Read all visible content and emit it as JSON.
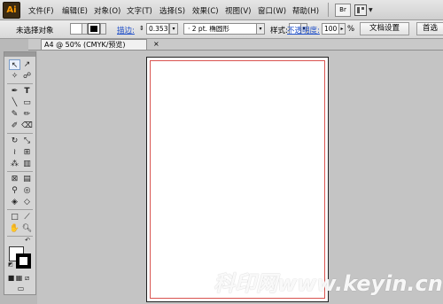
{
  "app": {
    "logo": "Ai"
  },
  "menu": {
    "items": [
      "文件(F)",
      "编辑(E)",
      "对象(O)",
      "文字(T)",
      "选择(S)",
      "效果(C)",
      "视图(V)",
      "窗口(W)",
      "帮助(H)"
    ],
    "bridge_label": "Br"
  },
  "control_bar": {
    "selection_status": "未选择对象",
    "stroke_label": "描边:",
    "stroke_weight": "0.353",
    "brush_label": "2 pt. 椭圆形",
    "style_label": "样式:",
    "opacity_label": "不透明度:",
    "opacity_value": "100",
    "opacity_unit": "%",
    "document_setup_button": "文档设置",
    "preferences_button": "首选"
  },
  "document_tab": {
    "title": "A4 @ 50% (CMYK/预览)",
    "close": "×"
  },
  "watermark": "科印网www.keyin.cn",
  "colors": {
    "artboard_border": "#222222",
    "bleed_guide": "#d9534f",
    "link_blue": "#1f4fc8"
  }
}
